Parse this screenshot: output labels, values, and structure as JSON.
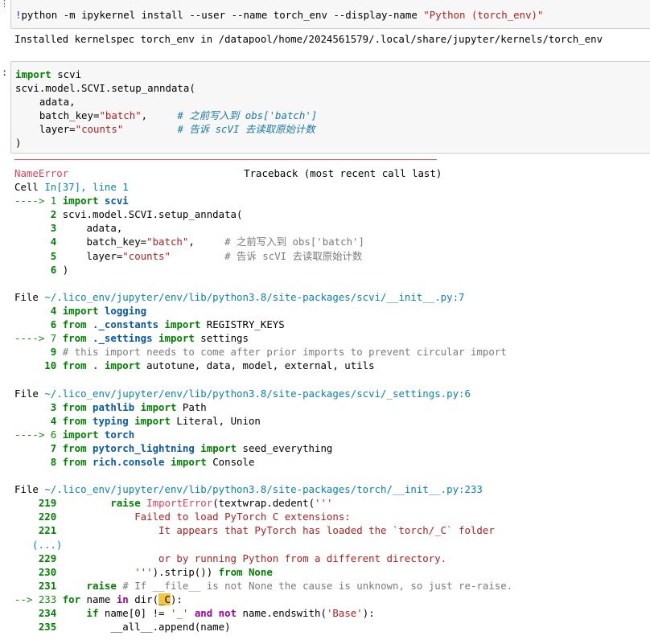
{
  "cell1": {
    "bang": "!",
    "command": "python -m ipykernel install --user --name torch_env --display-name ",
    "display_name": "\"Python (torch_env)\"",
    "output": "Installed kernelspec torch_env in /datapool/home/2024561579/.local/share/jupyter/kernels/torch_env"
  },
  "cell2": {
    "prompt": ":",
    "lines": {
      "l1_kw": "import",
      "l1_rest": " scvi",
      "l2": "scvi.model.SCVI.setup_anndata(",
      "l3": "    adata,",
      "l4_a": "    batch_key=",
      "l4_str": "\"batch\"",
      "l4_b": ",     ",
      "l4_cmt": "# 之前写入到 obs['batch']",
      "l5_a": "    layer=",
      "l5_str": "\"counts\"",
      "l5_b": "         ",
      "l5_cmt": "# 告诉 scVI 去读取原始计数",
      "l6": ")"
    }
  },
  "traceback": {
    "error_name": "NameError",
    "header_right": "Traceback (most recent call last)",
    "cell_ref_a": "Cell ",
    "cell_ref_b": "In[37], line 1",
    "frame0": {
      "a1": "----> 1 ",
      "l1_kw": "import",
      "l1_mod": " scvi",
      "n2": "      2 ",
      "l2": "scvi.model.SCVI.setup_anndata(",
      "n3": "      3 ",
      "l3": "    adata,",
      "n4": "      4 ",
      "l4_a": "    batch_key=",
      "l4_str": "\"batch\"",
      "l4_b": ",     ",
      "l4_cmt": "# 之前写入到 obs['batch']",
      "n5": "      5 ",
      "l5_a": "    layer=",
      "l5_str": "\"counts\"",
      "l5_b": "         ",
      "l5_cmt": "# 告诉 scVI 去读取原始计数",
      "n6": "      6 ",
      "l6": ")"
    },
    "frame1": {
      "file_label": "File ",
      "path": "~/.lico_env/jupyter/env/lib/python3.8/site-packages/scvi/__init__.py:7",
      "n4": "      4 ",
      "l4_kw": "import",
      "l4_mod": " logging",
      "n6": "      6 ",
      "l6_kw": "from",
      "l6_mod": " ._constants",
      "l6_kw2": " import",
      "l6_rest": " REGISTRY_KEYS",
      "a7": "----> 7 ",
      "l7_kw": "from",
      "l7_mod": " ._settings",
      "l7_kw2": " import",
      "l7_rest": " settings",
      "n9": "      9 ",
      "l9_cmt": "# this import needs to come after prior imports to prevent circular import",
      "n10": "     10 ",
      "l10_kw": "from",
      "l10_mod": " .",
      "l10_kw2": " import",
      "l10_rest": " autotune, data, model, external, utils"
    },
    "frame2": {
      "file_label": "File ",
      "path": "~/.lico_env/jupyter/env/lib/python3.8/site-packages/scvi/_settings.py:6",
      "n3": "      3 ",
      "l3_kw": "from",
      "l3_mod": " pathlib",
      "l3_kw2": " import",
      "l3_rest": " Path",
      "n4": "      4 ",
      "l4_kw": "from",
      "l4_mod": " typing",
      "l4_kw2": " import",
      "l4_rest": " Literal, Union",
      "a6": "----> 6 ",
      "l6_kw": "import",
      "l6_mod": " torch",
      "n7": "      7 ",
      "l7_kw": "from",
      "l7_mod": " pytorch_lightning",
      "l7_kw2": " import",
      "l7_rest": " seed_everything",
      "n8": "      8 ",
      "l8_kw": "from",
      "l8_mod": " rich.console",
      "l8_kw2": " import",
      "l8_rest": " Console"
    },
    "frame3": {
      "file_label": "File ",
      "path": "~/.lico_env/jupyter/env/lib/python3.8/site-packages/torch/__init__.py:233",
      "n219": "    219 ",
      "l219_ind": "        ",
      "l219_kw": "raise",
      "l219_exc": " ImportError",
      "l219_rest": "(textwrap.dedent(",
      "l219_str": "'''",
      "n220": "    220 ",
      "l220": "            Failed to load PyTorch C extensions:",
      "n221": "    221 ",
      "l221": "                It appears that PyTorch has loaded the `torch/_C` folder",
      "ellipsis": "(...)",
      "n229": "    229 ",
      "l229": "                or by running Python from a different directory.",
      "n230": "    230 ",
      "l230_str": "            '''",
      "l230_rest": ").strip()) ",
      "l230_kw": "from",
      "l230_kw2": " None",
      "n231": "    231 ",
      "l231_ind": "    ",
      "l231_kw": "raise",
      "l231_cmt": " # If __file__ is not None the cause is unknown, so just re-raise.",
      "a233": "--> 233 ",
      "l233_kw": "for",
      "l233_a": " name ",
      "l233_kw2": "in",
      "l233_b": " dir(",
      "l233_hl": "_C",
      "l233_c": "):",
      "n234": "    234 ",
      "l234_ind": "    ",
      "l234_kw": "if",
      "l234_a": " name[0] != ",
      "l234_str": "'_'",
      "l234_kw2": " and",
      "l234_kw3": " not",
      "l234_b": " name.endswith(",
      "l234_str2": "'Base'",
      "l234_c": "):",
      "n235": "    235 ",
      "l235": "        __all__.append(name)"
    }
  }
}
